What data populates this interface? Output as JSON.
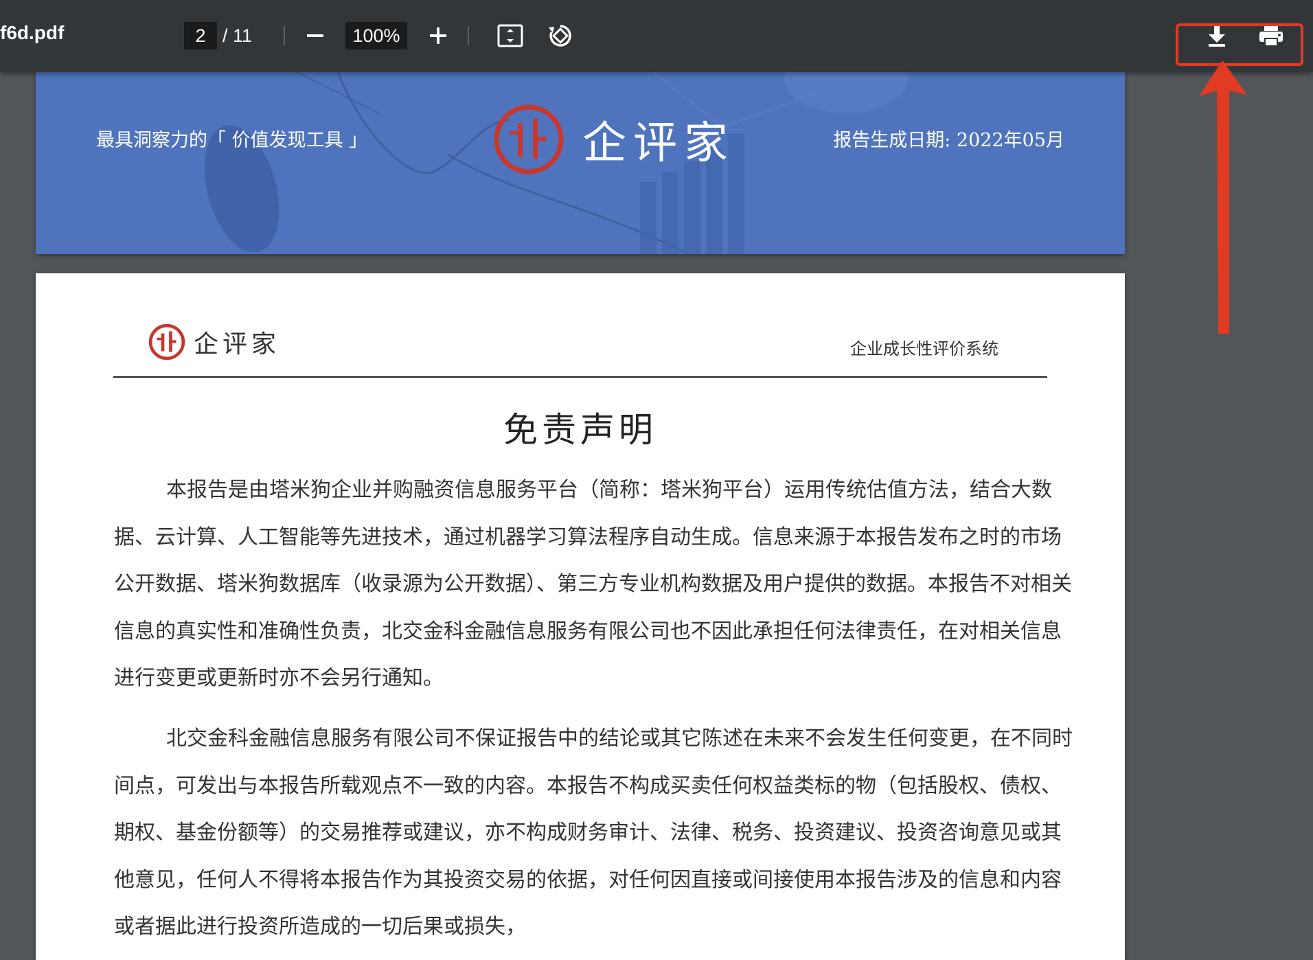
{
  "toolbar": {
    "filename": "f6d.pdf",
    "current_page": "2",
    "page_total": "/ 11",
    "zoom": "100%",
    "icons": [
      "zoom-out-icon",
      "zoom-in-icon",
      "fit-page-icon",
      "rotate-icon",
      "download-icon",
      "print-icon"
    ]
  },
  "annotation": {
    "color": "#e23b24"
  },
  "banner": {
    "left_text": "最具洞察力的「 价值发现工具 」",
    "logo_text": "企评家",
    "right_text": "报告生成日期: 2022年05月",
    "background": "#4f74bd"
  },
  "page": {
    "header_logo_text": "企评家",
    "header_right": "企业成长性评价系统",
    "title": "免责声明",
    "paragraphs": [
      "本报告是由塔米狗企业并购融资信息服务平台（简称：塔米狗平台）运用传统估值方法，结合大数据、云计算、人工智能等先进技术，通过机器学习算法程序自动生成。信息来源于本报告发布之时的市场公开数据、塔米狗数据库（收录源为公开数据）、第三方专业机构数据及用户提供的数据。本报告不对相关信息的真实性和准确性负责，北交金科金融信息服务有限公司也不因此承担任何法律责任，在对相关信息进行变更或更新时亦不会另行通知。",
      "北交金科金融信息服务有限公司不保证报告中的结论或其它陈述在未来不会发生任何变更，在不同时间点，可发出与本报告所载观点不一致的内容。本报告不构成买卖任何权益类标的物（包括股权、债权、期权、基金份额等）的交易推荐或建议，亦不构成财务审计、法律、税务、投资建议、投资咨询意见或其他意见，任何人不得将本报告作为其投资交易的依据，对任何因直接或间接使用本报告涉及的信息和内容或者据此进行投资所造成的一切后果或损失，"
    ],
    "brand_color": "#c8372d"
  }
}
